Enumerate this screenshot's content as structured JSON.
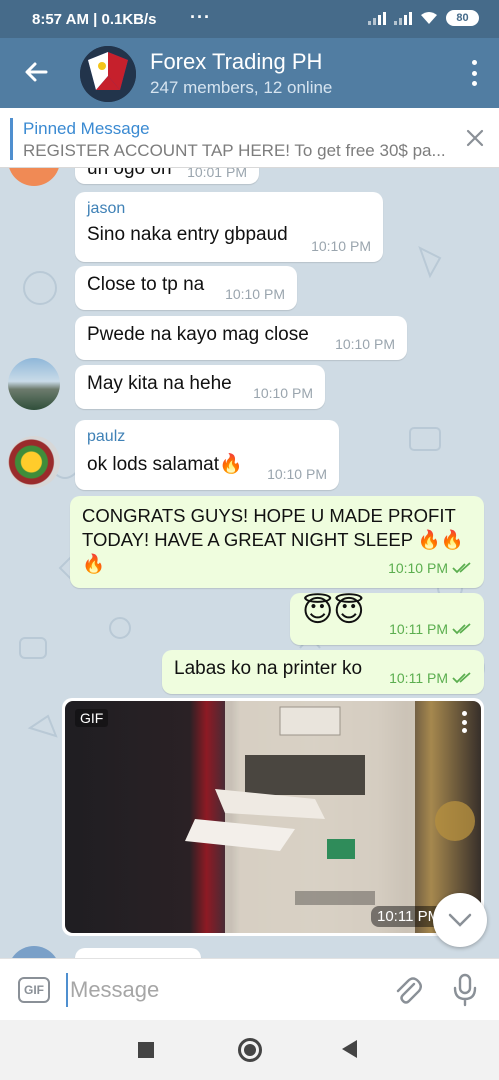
{
  "status_bar": {
    "time_speed": "8:57 AM | 0.1KB/s",
    "battery": "80"
  },
  "header": {
    "title": "Forex Trading PH",
    "subtitle": "247 members, 12 online"
  },
  "pinned": {
    "title": "Pinned Message",
    "text": "REGISTER ACCOUNT TAP HERE! To get free 30$ pa..."
  },
  "messages": {
    "partial": {
      "text": "un ogo on",
      "time": "10:01 PM"
    },
    "m1": {
      "sender": "jason",
      "text": "Sino naka entry gbpaud",
      "time": "10:10 PM"
    },
    "m2": {
      "text": "Close to tp na",
      "time": "10:10 PM"
    },
    "m3": {
      "text": "Pwede na kayo mag close",
      "time": "10:10 PM"
    },
    "m4": {
      "text": "May kita na hehe",
      "time": "10:10 PM"
    },
    "m5": {
      "sender": "paulz",
      "text": "ok lods salamat🔥",
      "time": "10:10 PM"
    },
    "m6": {
      "text": "CONGRATS GUYS! HOPE U MADE PROFIT TODAY! HAVE A GREAT NIGHT SLEEP 🔥🔥🔥",
      "time": "10:10 PM"
    },
    "m7": {
      "text": "😇😇",
      "time": "10:11 PM"
    },
    "m8": {
      "text": "Labas ko na printer ko",
      "time": "10:11 PM"
    },
    "gif": {
      "label": "GIF",
      "time": "10:11 PM"
    }
  },
  "composer": {
    "gif_label": "GIF",
    "placeholder": "Message"
  },
  "colors": {
    "header": "#517da2",
    "status_bar": "#466b8a",
    "chat_bg": "#cfdbe4",
    "outgoing": "#effdde",
    "accent": "#3a8ad2"
  },
  "icons": [
    "back-arrow-icon",
    "more-vert-icon",
    "close-icon",
    "chevron-down-icon",
    "attach-icon",
    "mic-icon",
    "double-check-icon"
  ]
}
